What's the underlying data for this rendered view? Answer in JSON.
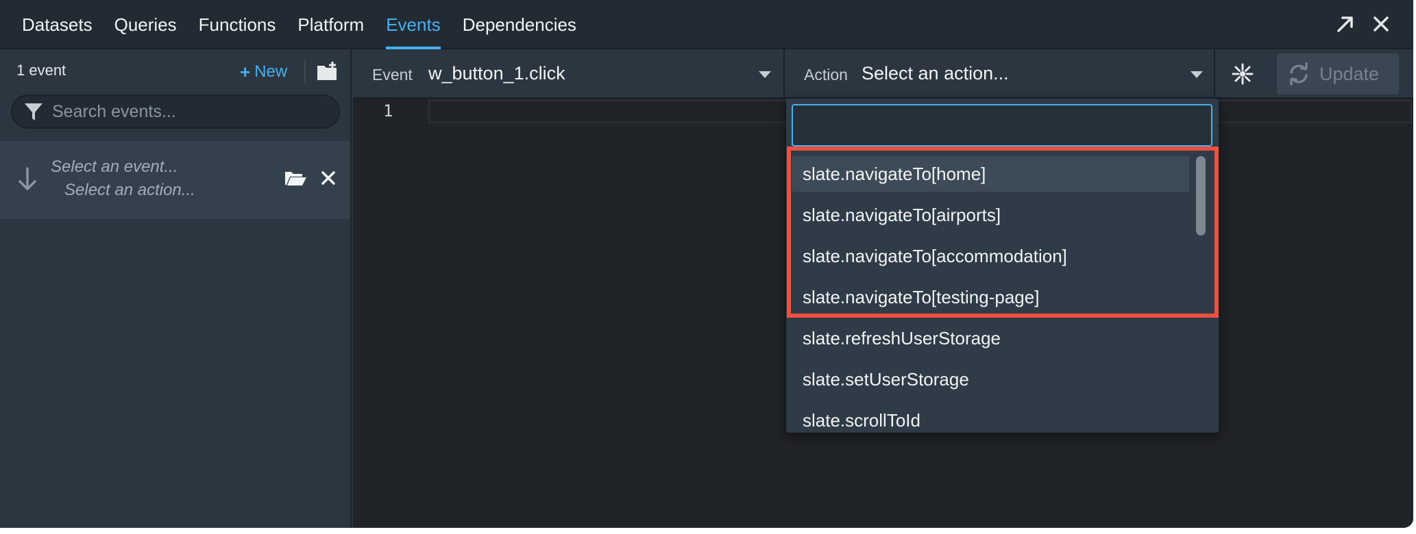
{
  "nav": {
    "tabs": [
      {
        "label": "Datasets"
      },
      {
        "label": "Queries"
      },
      {
        "label": "Functions"
      },
      {
        "label": "Platform"
      },
      {
        "label": "Events"
      },
      {
        "label": "Dependencies"
      }
    ],
    "active_tab": "Events",
    "icons": [
      "expand-icon",
      "close-icon"
    ]
  },
  "sidebar": {
    "event_count": "1 event",
    "new_label": "New",
    "search_placeholder": "Search events...",
    "event_item": {
      "event_placeholder": "Select an event...",
      "action_placeholder": "Select an action..."
    }
  },
  "event_bar": {
    "event_label": "Event",
    "event_value": "w_button_1.click",
    "action_label": "Action",
    "action_value": "Select an action...",
    "update_label": "Update"
  },
  "editor": {
    "line_number": "1"
  },
  "dropdown": {
    "search_value": "",
    "options": [
      "slate.navigateTo[home]",
      "slate.navigateTo[airports]",
      "slate.navigateTo[accommodation]",
      "slate.navigateTo[testing-page]",
      "slate.refreshUserStorage",
      "slate.setUserStorage",
      "slate.scrollToId"
    ],
    "hovered_index": 0
  },
  "colors": {
    "accent": "#48aff0",
    "highlight": "#f0503f"
  }
}
